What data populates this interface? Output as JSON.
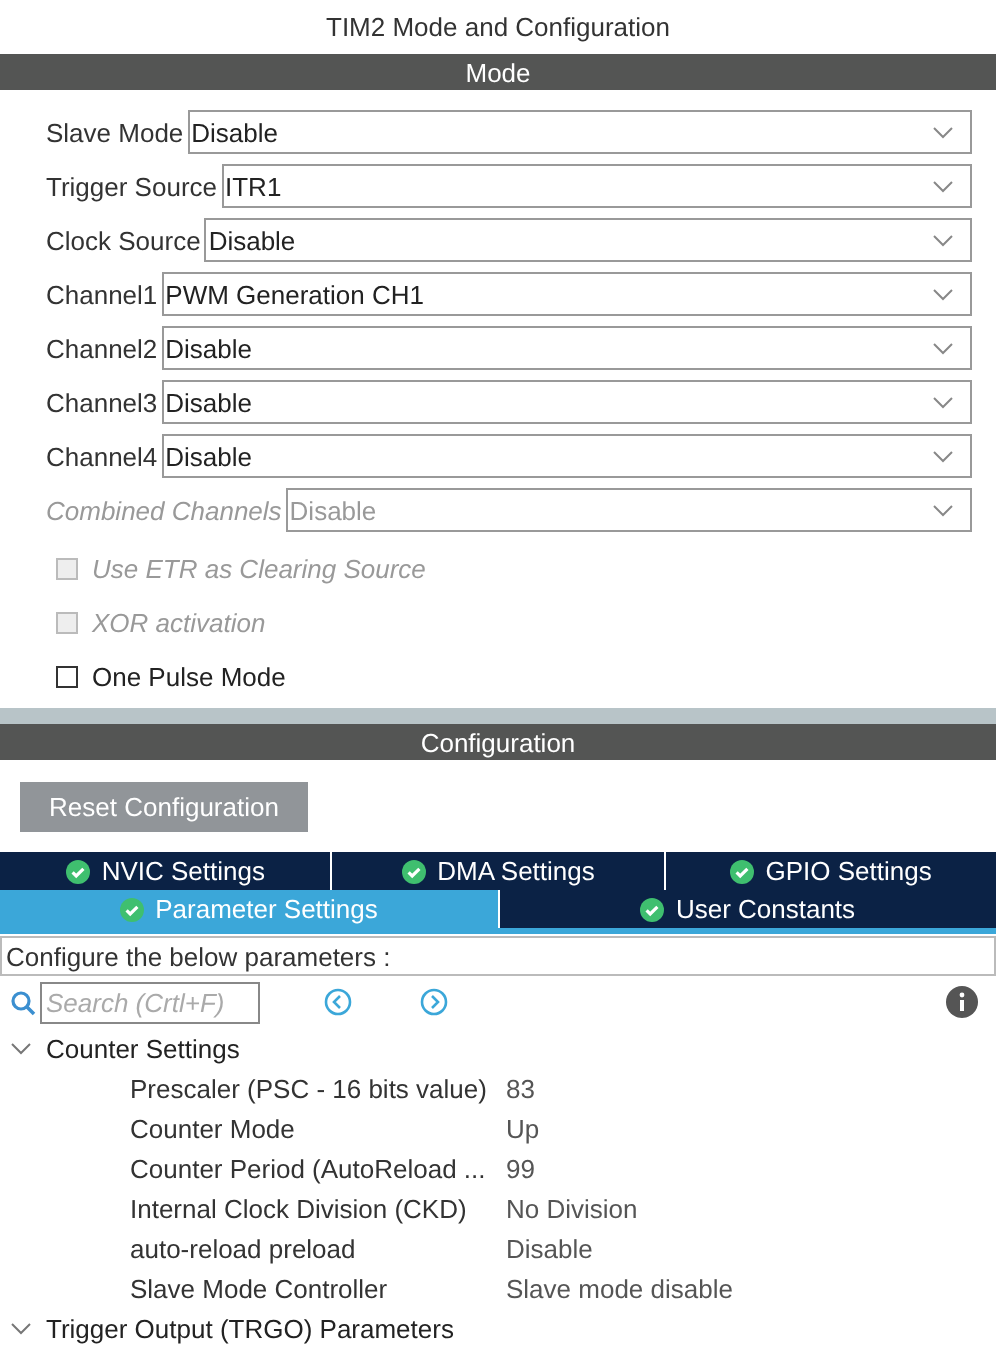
{
  "window": {
    "title": "TIM2 Mode and Configuration"
  },
  "mode": {
    "header": "Mode",
    "dropdowns": [
      {
        "label": "Slave Mode",
        "value": "Disable",
        "disabled": false
      },
      {
        "label": "Trigger Source",
        "value": "ITR1",
        "disabled": false
      },
      {
        "label": "Clock Source",
        "value": "Disable",
        "disabled": false
      },
      {
        "label": "Channel1",
        "value": "PWM Generation CH1",
        "disabled": false
      },
      {
        "label": "Channel2",
        "value": "Disable",
        "disabled": false
      },
      {
        "label": "Channel3",
        "value": "Disable",
        "disabled": false
      },
      {
        "label": "Channel4",
        "value": "Disable",
        "disabled": false
      },
      {
        "label": "Combined Channels",
        "value": "Disable",
        "disabled": true
      }
    ],
    "checkboxes": [
      {
        "label": "Use ETR as Clearing Source",
        "checked": false,
        "disabled": true
      },
      {
        "label": "XOR activation",
        "checked": false,
        "disabled": true
      },
      {
        "label": "One Pulse Mode",
        "checked": false,
        "disabled": false
      }
    ]
  },
  "configuration": {
    "header": "Configuration",
    "reset_button": "Reset Configuration",
    "tab_rows": [
      [
        {
          "label": "NVIC Settings",
          "selected": false
        },
        {
          "label": "DMA Settings",
          "selected": false
        },
        {
          "label": "GPIO Settings",
          "selected": false
        }
      ],
      [
        {
          "label": "Parameter Settings",
          "selected": true
        },
        {
          "label": "User Constants",
          "selected": false
        }
      ]
    ],
    "hint": "Configure the below parameters :",
    "search": {
      "placeholder": "Search (Crtl+F)"
    },
    "groups": [
      {
        "label": "Counter Settings",
        "expanded": true,
        "children": [
          {
            "name": "Prescaler (PSC - 16 bits value)",
            "value": "83"
          },
          {
            "name": "Counter Mode",
            "value": "Up"
          },
          {
            "name": "Counter Period (AutoReload ...",
            "value": "99"
          },
          {
            "name": "Internal Clock Division (CKD)",
            "value": "No Division"
          },
          {
            "name": "auto-reload preload",
            "value": "Disable"
          },
          {
            "name": "Slave Mode Controller",
            "value": "Slave mode disable"
          }
        ]
      },
      {
        "label": "Trigger Output (TRGO) Parameters",
        "expanded": true
      }
    ]
  }
}
